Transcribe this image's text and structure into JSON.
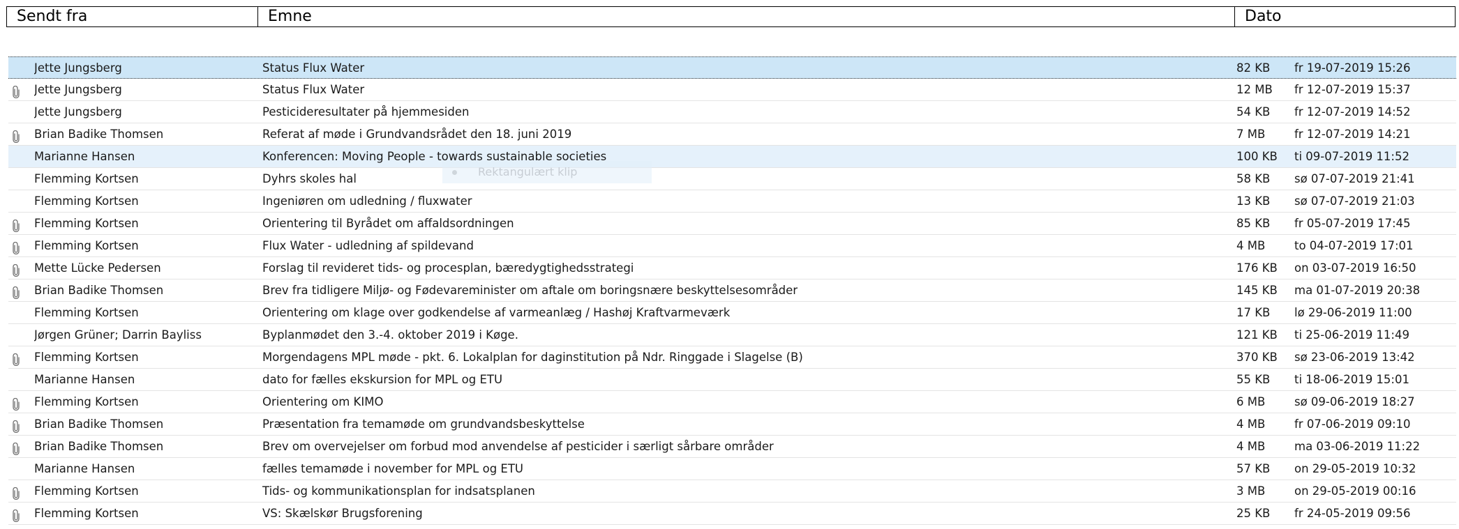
{
  "header": {
    "from_label": "Sendt fra",
    "subject_label": "Emne",
    "date_label": "Dato"
  },
  "ghost_tooltip": {
    "label": "Rektangulært klip"
  },
  "messages": [
    {
      "attachment": false,
      "from": "Jette Jungsberg",
      "subject": "Status Flux Water",
      "size": "82 KB",
      "date": "fr 19-07-2019 15:26",
      "state": "selected"
    },
    {
      "attachment": true,
      "from": "Jette Jungsberg",
      "subject": "Status Flux Water",
      "size": "12 MB",
      "date": "fr 12-07-2019 15:37",
      "state": ""
    },
    {
      "attachment": false,
      "from": "Jette Jungsberg",
      "subject": "Pesticideresultater på hjemmesiden",
      "size": "54 KB",
      "date": "fr 12-07-2019 14:52",
      "state": ""
    },
    {
      "attachment": true,
      "from": "Brian Badike Thomsen",
      "subject": "Referat af møde i Grundvandsrådet den 18. juni 2019",
      "size": "7 MB",
      "date": "fr 12-07-2019 14:21",
      "state": ""
    },
    {
      "attachment": false,
      "from": "Marianne Hansen",
      "subject": "Konferencen: Moving People - towards sustainable societies",
      "size": "100 KB",
      "date": "ti 09-07-2019 11:52",
      "state": "hover"
    },
    {
      "attachment": false,
      "from": "Flemming Kortsen",
      "subject": "Dyhrs skoles hal",
      "size": "58 KB",
      "date": "sø 07-07-2019 21:41",
      "state": ""
    },
    {
      "attachment": false,
      "from": "Flemming Kortsen",
      "subject": "Ingeniøren om udledning / fluxwater",
      "size": "13 KB",
      "date": "sø 07-07-2019 21:03",
      "state": ""
    },
    {
      "attachment": true,
      "from": "Flemming Kortsen",
      "subject": "Orientering til Byrådet om affaldsordningen",
      "size": "85 KB",
      "date": "fr 05-07-2019 17:45",
      "state": ""
    },
    {
      "attachment": true,
      "from": "Flemming Kortsen",
      "subject": "Flux Water - udledning af spildevand",
      "size": "4 MB",
      "date": "to 04-07-2019 17:01",
      "state": ""
    },
    {
      "attachment": true,
      "from": "Mette Lücke Pedersen",
      "subject": "Forslag til revideret tids- og procesplan, bæredygtighedsstrategi",
      "size": "176 KB",
      "date": "on 03-07-2019 16:50",
      "state": ""
    },
    {
      "attachment": true,
      "from": "Brian Badike Thomsen",
      "subject": "Brev fra tidligere Miljø- og Fødevareminister om aftale om boringsnære beskyttelsesområder",
      "size": "145 KB",
      "date": "ma 01-07-2019 20:38",
      "state": ""
    },
    {
      "attachment": false,
      "from": "Flemming Kortsen",
      "subject": "Orientering om klage over godkendelse af varmeanlæg / Hashøj Kraftvarmeværk",
      "size": "17 KB",
      "date": "lø 29-06-2019 11:00",
      "state": ""
    },
    {
      "attachment": false,
      "from": "Jørgen Grüner;  Darrin Bayliss",
      "subject": "Byplanmødet den 3.-4. oktober 2019 i Køge.",
      "size": "121 KB",
      "date": "ti 25-06-2019 11:49",
      "state": ""
    },
    {
      "attachment": true,
      "from": "Flemming Kortsen",
      "subject": "Morgendagens MPL møde - pkt. 6. Lokalplan for daginstitution på Ndr. Ringgade i Slagelse (B)",
      "size": "370 KB",
      "date": "sø 23-06-2019 13:42",
      "state": ""
    },
    {
      "attachment": false,
      "from": "Marianne Hansen",
      "subject": "dato for fælles ekskursion for MPL og ETU",
      "size": "55 KB",
      "date": "ti 18-06-2019 15:01",
      "state": ""
    },
    {
      "attachment": true,
      "from": "Flemming Kortsen",
      "subject": "Orientering om KIMO",
      "size": "6 MB",
      "date": "sø 09-06-2019 18:27",
      "state": ""
    },
    {
      "attachment": true,
      "from": "Brian Badike Thomsen",
      "subject": "Præsentation fra temamøde om grundvandsbeskyttelse",
      "size": "4 MB",
      "date": "fr 07-06-2019 09:10",
      "state": ""
    },
    {
      "attachment": true,
      "from": "Brian Badike Thomsen",
      "subject": "Brev om overvejelser om forbud mod anvendelse af pesticider i særligt sårbare områder",
      "size": "4 MB",
      "date": "ma 03-06-2019 11:22",
      "state": ""
    },
    {
      "attachment": false,
      "from": "Marianne Hansen",
      "subject": "fælles temamøde i november for MPL og ETU",
      "size": "57 KB",
      "date": "on 29-05-2019 10:32",
      "state": ""
    },
    {
      "attachment": true,
      "from": "Flemming Kortsen",
      "subject": "Tids- og kommunikationsplan for indsatsplanen",
      "size": "3 MB",
      "date": "on 29-05-2019 00:16",
      "state": ""
    },
    {
      "attachment": true,
      "from": "Flemming Kortsen",
      "subject": "VS: Skælskør Brugsforening",
      "size": "25 KB",
      "date": "fr 24-05-2019 09:56",
      "state": ""
    }
  ],
  "colors": {
    "selected_bg": "#cde6f7",
    "hover_bg": "#e5f1fb",
    "row_divider": "#e4e4e4",
    "attachment_icon": "#6f6f6f"
  },
  "icons": {
    "attachment": "paperclip-icon"
  }
}
